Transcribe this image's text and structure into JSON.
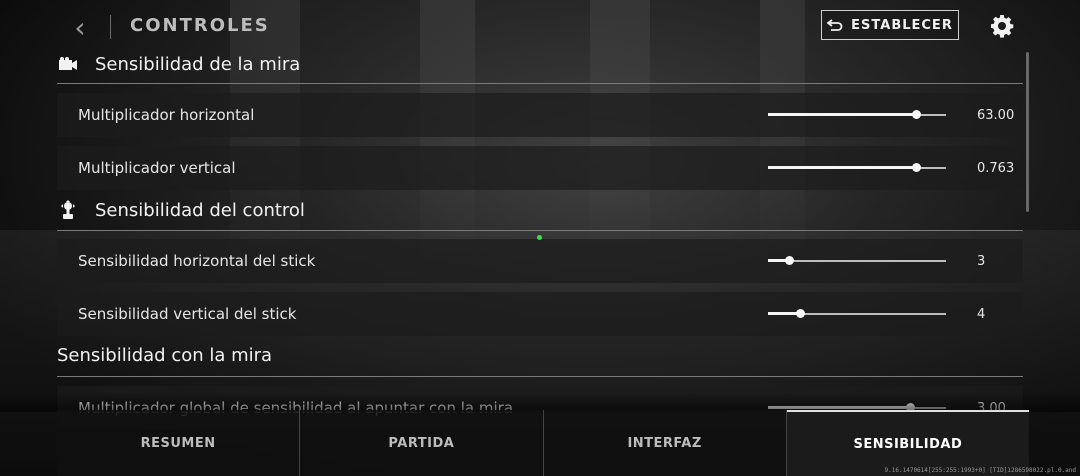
{
  "header": {
    "back_glyph": "‹",
    "title": "CONTROLES",
    "reset_label": "ESTABLECER"
  },
  "sections": [
    {
      "title": "Sensibilidad de la mira",
      "icon": "camera-icon",
      "rows": [
        {
          "label": "Multiplicador horizontal",
          "value": "63.00",
          "level": 0.83
        },
        {
          "label": "Multiplicador vertical",
          "value": "0.763",
          "level": 0.83
        }
      ]
    },
    {
      "title": "Sensibilidad del control",
      "icon": "joystick-icon",
      "rows": [
        {
          "label": "Sensibilidad horizontal del stick",
          "value": "3",
          "level": 0.12
        },
        {
          "label": "Sensibilidad vertical del stick",
          "value": "4",
          "level": 0.18
        }
      ]
    },
    {
      "title": "Sensibilidad con la mira",
      "rows": [
        {
          "label": "Multiplicador global de sensibilidad al apuntar con la mira",
          "value": "3.00",
          "level": 0.8
        }
      ]
    }
  ],
  "tabs": [
    {
      "label": "RESUMEN",
      "active": false
    },
    {
      "label": "PARTIDA",
      "active": false
    },
    {
      "label": "INTERFAZ",
      "active": false
    },
    {
      "label": "SENSIBILIDAD",
      "active": true
    }
  ],
  "footer_text": "9.16.1470614[255:255:1993+0] [TID]1286598022.pl.0.and",
  "colors": {
    "accent": "#ffffff",
    "status_dot": "#2ee04a"
  }
}
